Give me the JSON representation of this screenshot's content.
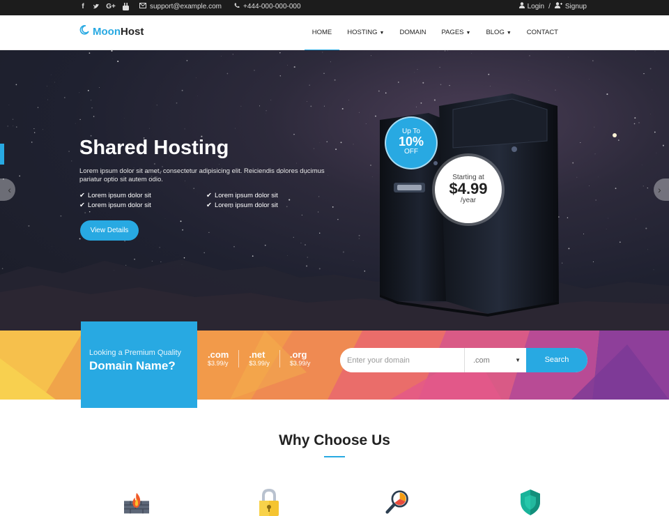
{
  "topbar": {
    "social_icons": [
      "facebook-icon",
      "twitter-icon",
      "google-plus-icon",
      "youtube-icon"
    ],
    "email": "support@example.com",
    "phone": "+444-000-000-000",
    "login": "Login",
    "signup": "Signup",
    "separator": "/"
  },
  "nav": {
    "logo_part1": "Moon",
    "logo_part2": "Host",
    "items": [
      {
        "label": "HOME",
        "active": true,
        "dropdown": false
      },
      {
        "label": "HOSTING",
        "active": false,
        "dropdown": true
      },
      {
        "label": "DOMAIN",
        "active": false,
        "dropdown": false
      },
      {
        "label": "PAGES",
        "active": false,
        "dropdown": true
      },
      {
        "label": "BLOG",
        "active": false,
        "dropdown": true
      },
      {
        "label": "CONTACT",
        "active": false,
        "dropdown": false
      }
    ]
  },
  "hero": {
    "title": "Shared Hosting",
    "description": "Lorem ipsum dolor sit amet, consectetur adipisicing elit. Reiciendis dolores ducimus pariatur optio sit autem odio.",
    "features": [
      "Lorem ipsum dolor sit",
      "Lorem ipsum dolor sit",
      "Lorem ipsum dolor sit",
      "Lorem ipsum dolor sit"
    ],
    "button": "View Details",
    "discount": {
      "line1": "Up To",
      "line2": "10%",
      "line3": "OFF"
    },
    "price": {
      "line1": "Starting at",
      "line2": "$4.99",
      "line3": "/year"
    },
    "prev_arrow": "‹",
    "next_arrow": "›"
  },
  "domain": {
    "question": "Looking a Premium Quality",
    "bold": "Domain Name?",
    "tlds": [
      {
        "name": ".com",
        "price": "$3.99/y"
      },
      {
        "name": ".net",
        "price": "$3.99/y"
      },
      {
        "name": ".org",
        "price": "$3.99/y"
      }
    ],
    "search_placeholder": "Enter your domain",
    "select_value": ".com",
    "search_button": "Search"
  },
  "why": {
    "title": "Why Choose Us",
    "icons": [
      "firewall-icon",
      "lock-icon",
      "analytics-magnifier-icon",
      "shield-icon"
    ]
  },
  "colors": {
    "accent": "#28a9e2",
    "topbar": "#1c1c1c"
  }
}
